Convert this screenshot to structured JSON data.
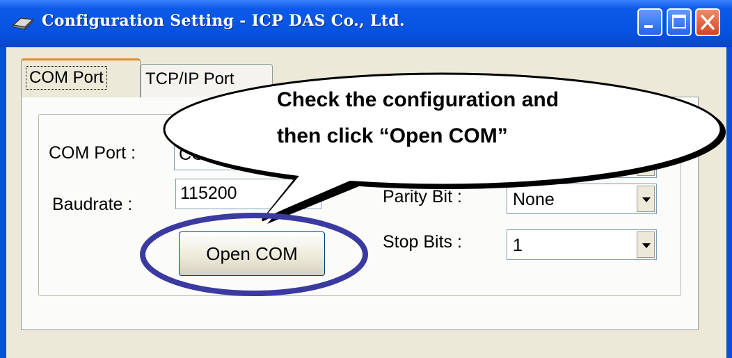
{
  "window": {
    "title": "Configuration Setting - ICP DAS Co., Ltd.",
    "icon": "app-icon",
    "controls": [
      "minimize-icon",
      "maximize-icon",
      "close-icon"
    ]
  },
  "tabs": [
    {
      "label": "COM Port",
      "selected": true
    },
    {
      "label": "TCP/IP Port",
      "selected": false
    }
  ],
  "form": {
    "com_port_label": "COM Port :",
    "com_port_value": "COM2",
    "baudrate_label": "Baudrate :",
    "baudrate_value": "115200",
    "parity_label": "Parity Bit :",
    "parity_value": "None",
    "stop_label": "Stop Bits :",
    "stop_value": "1",
    "open_button": "Open COM"
  },
  "callout": {
    "line1": "Check the configuration and",
    "line2": "then click “Open COM”"
  },
  "colors": {
    "titlebar": "#0552e0",
    "window_bg": "#ece9d8",
    "highlight_ellipse": "#3a3aa0",
    "close_button": "#d64420"
  }
}
